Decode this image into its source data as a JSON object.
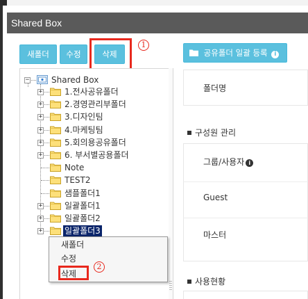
{
  "window": {
    "title": "Shared Box"
  },
  "toolbar": {
    "new_folder": "새폴더",
    "edit": "수정",
    "delete": "삭제",
    "bulk_register": "공유폴더 일괄 등록"
  },
  "annotations": {
    "marker1": "1",
    "marker2": "2",
    "highlight_color": "#e8281d"
  },
  "tree": {
    "root": "Shared Box",
    "items": [
      {
        "label": "1.전사공유폴더",
        "expandable": true
      },
      {
        "label": "2.경영관리부폴더",
        "expandable": true
      },
      {
        "label": "3.디자인팀",
        "expandable": true
      },
      {
        "label": "4.마케팅팀",
        "expandable": true
      },
      {
        "label": "5.회의용공유폴더",
        "expandable": true
      },
      {
        "label": "6. 부서별공용폴더",
        "expandable": true
      },
      {
        "label": "Note",
        "expandable": false
      },
      {
        "label": "TEST2",
        "expandable": false
      },
      {
        "label": "샘플폴더1",
        "expandable": false
      },
      {
        "label": "일괄폴더1",
        "expandable": true
      },
      {
        "label": "일괄폴더2",
        "expandable": true
      },
      {
        "label": "일괄폴더3",
        "expandable": true,
        "selected": true
      }
    ]
  },
  "context_menu": {
    "items": [
      "새폴더",
      "수정",
      "삭제"
    ]
  },
  "right_panel": {
    "folder_name_label": "폴더명",
    "members_section": "구성원 관리",
    "group_user_label": "그룹/사용자",
    "guest_label": "Guest",
    "master_label": "마스터",
    "usage_section": "사용현황"
  },
  "colors": {
    "button": "#5bc0de",
    "header": "#5a5a5a",
    "selection": "#0a246a"
  }
}
